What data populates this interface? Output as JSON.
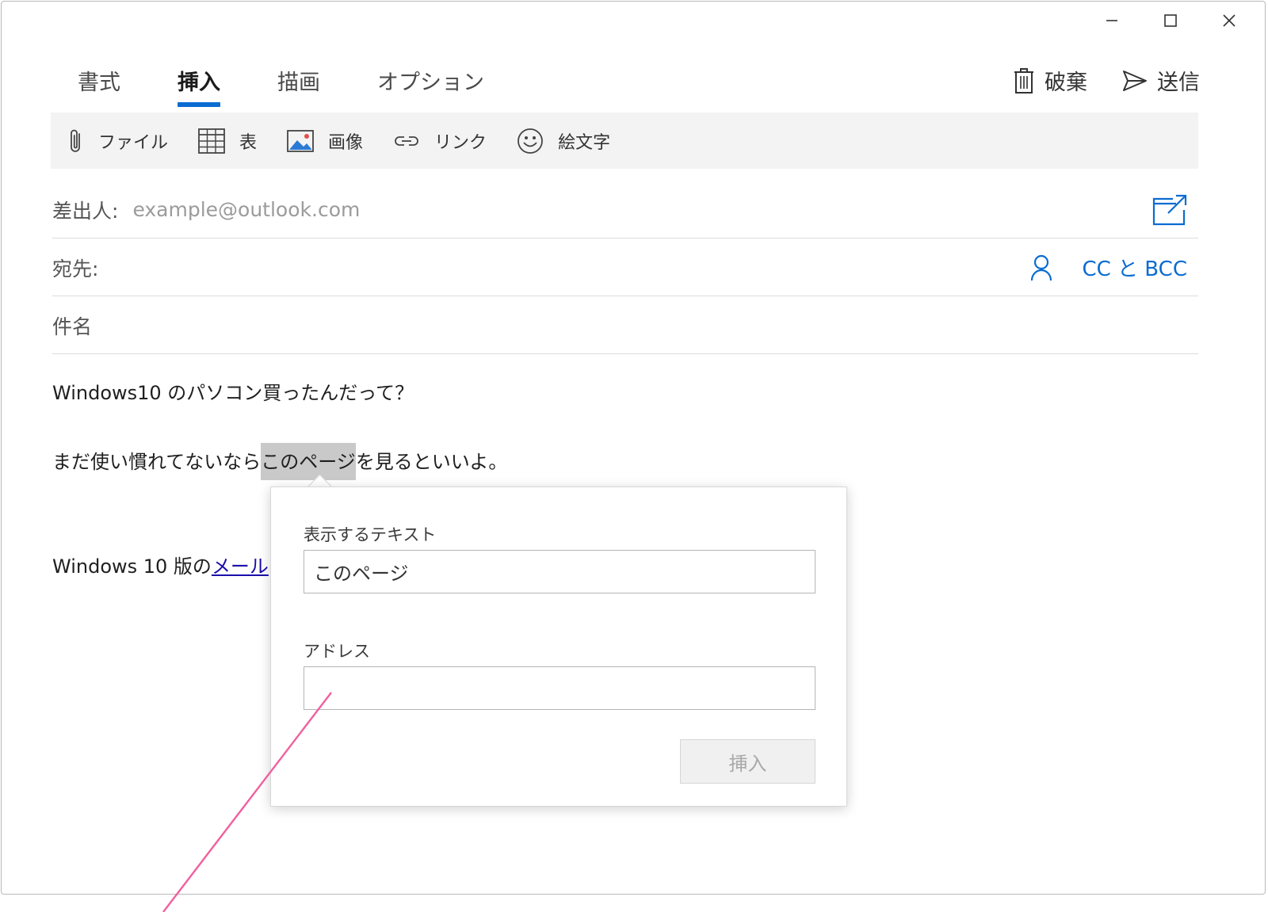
{
  "tabs": [
    {
      "label": "書式",
      "active": false
    },
    {
      "label": "挿入",
      "active": true
    },
    {
      "label": "描画",
      "active": false
    },
    {
      "label": "オプション",
      "active": false
    }
  ],
  "actions": {
    "discard": "破棄",
    "send": "送信"
  },
  "ribbon": {
    "file": "ファイル",
    "table": "表",
    "image": "画像",
    "link": "リンク",
    "emoji": "絵文字"
  },
  "from": {
    "label": "差出人:",
    "value": "example@outlook.com"
  },
  "to": {
    "label": "宛先:",
    "cc_bcc": "CC と BCC"
  },
  "subject": {
    "label": "件名"
  },
  "body": {
    "line1": "Windows10 のパソコン買ったんだって？",
    "line2_before": "まだ使い慣れてないなら",
    "line2_selected": "このページ",
    "line2_after": "を見るといいよ。",
    "line3_before": "Windows 10 版の",
    "line3_link": "メール"
  },
  "popup": {
    "text_label": "表示するテキスト",
    "text_value": "このページ",
    "address_label": "アドレス",
    "address_value": "",
    "insert_button": "挿入"
  },
  "colors": {
    "accent": "#0a6cd1",
    "annotation": "#f0609e"
  }
}
